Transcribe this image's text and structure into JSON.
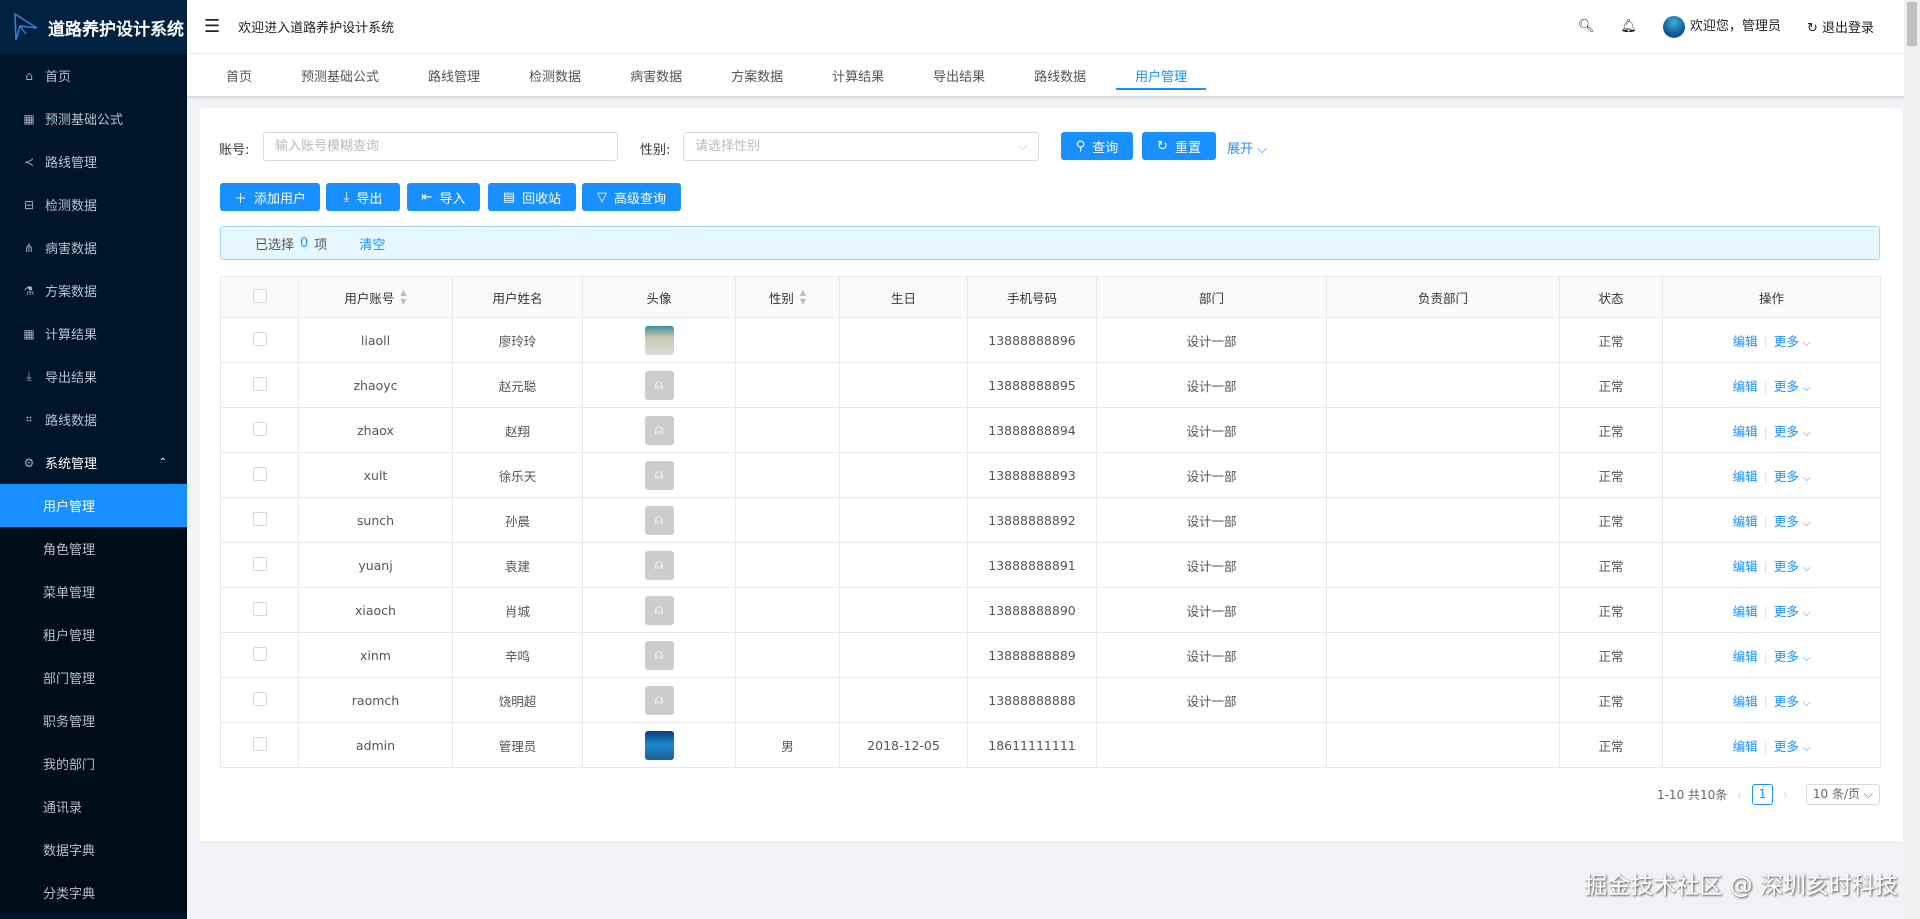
{
  "app": {
    "title": "道路养护设计系统",
    "welcome": "欢迎进入道路养护设计系统",
    "user": "欢迎您，管理员",
    "logout": "退出登录"
  },
  "sidebar": {
    "items": [
      {
        "label": "首页",
        "icon": "home-icon"
      },
      {
        "label": "预测基础公式",
        "icon": "table-icon"
      },
      {
        "label": "路线管理",
        "icon": "share-icon"
      },
      {
        "label": "检测数据",
        "icon": "inbox-icon"
      },
      {
        "label": "病害数据",
        "icon": "cluster-icon"
      },
      {
        "label": "方案数据",
        "icon": "flask-icon"
      },
      {
        "label": "计算结果",
        "icon": "table-icon"
      },
      {
        "label": "导出结果",
        "icon": "download-icon"
      },
      {
        "label": "路线数据",
        "icon": "node-icon"
      },
      {
        "label": "系统管理",
        "icon": "gear-icon"
      }
    ],
    "sub": [
      "用户管理",
      "角色管理",
      "菜单管理",
      "租户管理",
      "部门管理",
      "职务管理",
      "我的部门",
      "通讯录",
      "数据字典",
      "分类字典"
    ]
  },
  "tabs": [
    "首页",
    "预测基础公式",
    "路线管理",
    "检测数据",
    "病害数据",
    "方案数据",
    "计算结果",
    "导出结果",
    "路线数据",
    "用户管理"
  ],
  "active_tab": "用户管理",
  "search": {
    "account_label": "账号:",
    "account_placeholder": "输入账号模糊查询",
    "gender_label": "性别:",
    "gender_placeholder": "请选择性别",
    "query": "查询",
    "reset": "重置",
    "expand": "展开"
  },
  "toolbar": {
    "add": "添加用户",
    "export": "导出",
    "import": "导入",
    "recycle": "回收站",
    "advanced": "高级查询"
  },
  "alert": {
    "selected_prefix": "已选择",
    "count": "0",
    "suffix": "项",
    "clear": "清空"
  },
  "table": {
    "headers": [
      "用户账号",
      "用户姓名",
      "头像",
      "性别",
      "生日",
      "手机号码",
      "部门",
      "负责部门",
      "状态",
      "操作"
    ],
    "rows": [
      {
        "account": "liaoll",
        "name": "廖玲玲",
        "avatar": "photo1",
        "gender": "",
        "birthday": "",
        "phone": "13888888896",
        "dept": "设计一部",
        "leader_dept": "",
        "status": "正常"
      },
      {
        "account": "zhaoyc",
        "name": "赵元聪",
        "avatar": "default",
        "gender": "",
        "birthday": "",
        "phone": "13888888895",
        "dept": "设计一部",
        "leader_dept": "",
        "status": "正常"
      },
      {
        "account": "zhaox",
        "name": "赵翔",
        "avatar": "default",
        "gender": "",
        "birthday": "",
        "phone": "13888888894",
        "dept": "设计一部",
        "leader_dept": "",
        "status": "正常"
      },
      {
        "account": "xult",
        "name": "徐乐天",
        "avatar": "default",
        "gender": "",
        "birthday": "",
        "phone": "13888888893",
        "dept": "设计一部",
        "leader_dept": "",
        "status": "正常"
      },
      {
        "account": "sunch",
        "name": "孙晨",
        "avatar": "default",
        "gender": "",
        "birthday": "",
        "phone": "13888888892",
        "dept": "设计一部",
        "leader_dept": "",
        "status": "正常"
      },
      {
        "account": "yuanj",
        "name": "袁建",
        "avatar": "default",
        "gender": "",
        "birthday": "",
        "phone": "13888888891",
        "dept": "设计一部",
        "leader_dept": "",
        "status": "正常"
      },
      {
        "account": "xiaoch",
        "name": "肖城",
        "avatar": "default",
        "gender": "",
        "birthday": "",
        "phone": "13888888890",
        "dept": "设计一部",
        "leader_dept": "",
        "status": "正常"
      },
      {
        "account": "xinm",
        "name": "辛鸣",
        "avatar": "default",
        "gender": "",
        "birthday": "",
        "phone": "13888888889",
        "dept": "设计一部",
        "leader_dept": "",
        "status": "正常"
      },
      {
        "account": "raomch",
        "name": "饶明超",
        "avatar": "default",
        "gender": "",
        "birthday": "",
        "phone": "13888888888",
        "dept": "设计一部",
        "leader_dept": "",
        "status": "正常"
      },
      {
        "account": "admin",
        "name": "管理员",
        "avatar": "photo2",
        "gender": "男",
        "birthday": "2018-12-05",
        "phone": "18611111111",
        "dept": "",
        "leader_dept": "",
        "status": "正常"
      }
    ],
    "edit": "编辑",
    "more": "更多"
  },
  "pagination": {
    "total": "1-10 共10条",
    "page": "1",
    "size": "10 条/页"
  },
  "watermark": "掘金技术社区 @ 深圳亥时科技",
  "colors": {
    "primary": "#1890ff",
    "sidebar": "#001529"
  }
}
